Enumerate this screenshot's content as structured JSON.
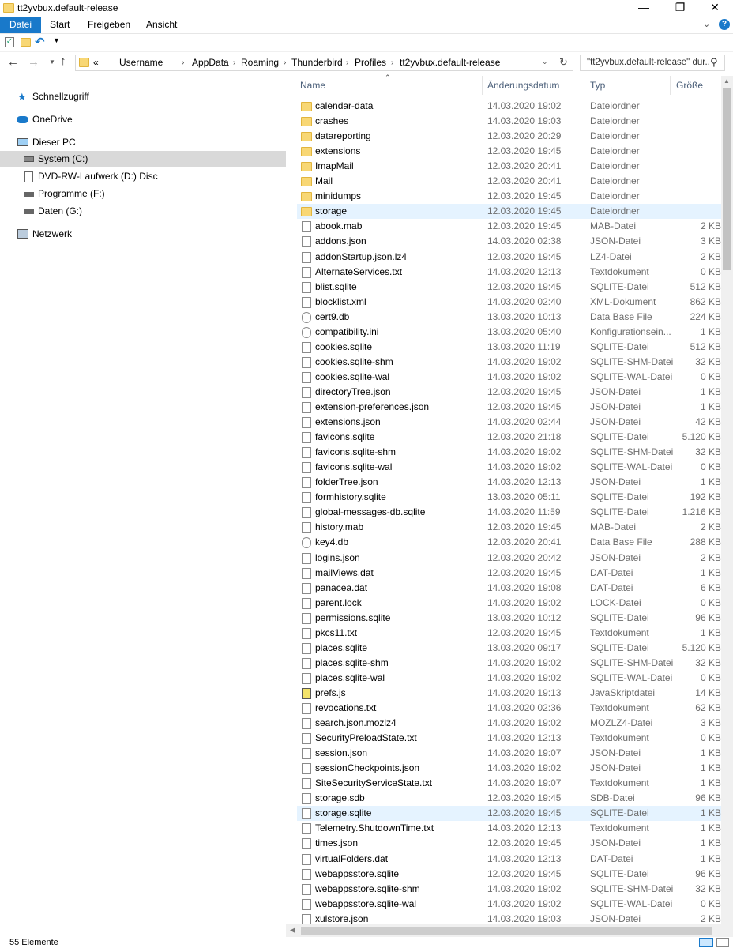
{
  "window": {
    "title": "tt2yvbux.default-release"
  },
  "ribbon": {
    "tabs": [
      "Datei",
      "Start",
      "Freigeben",
      "Ansicht"
    ]
  },
  "address": {
    "prefix": "«",
    "crumbs": [
      "Username",
      "AppData",
      "Roaming",
      "Thunderbird",
      "Profiles",
      "tt2yvbux.default-release"
    ]
  },
  "search": {
    "placeholder": "\"tt2yvbux.default-release\" dur..."
  },
  "nav": {
    "items": [
      {
        "label": "Schnellzugriff",
        "icon": "star-icon"
      },
      {
        "label": "OneDrive",
        "icon": "cloud-icon"
      },
      {
        "label": "Dieser PC",
        "icon": "computer-icon"
      },
      {
        "label": "System (C:)",
        "icon": "drive-icon"
      },
      {
        "label": "DVD-RW-Laufwerk (D:) Disc",
        "icon": "disc-icon"
      },
      {
        "label": "Programme (F:)",
        "icon": "drive-icon"
      },
      {
        "label": "Daten (G:)",
        "icon": "drive-icon"
      },
      {
        "label": "Netzwerk",
        "icon": "network-icon"
      }
    ]
  },
  "columns": {
    "name": "Name",
    "date": "Änderungsdatum",
    "type": "Typ",
    "size": "Größe"
  },
  "files": [
    {
      "name": "calendar-data",
      "date": "14.03.2020 19:02",
      "type": "Dateiordner",
      "size": "",
      "kind": "folder"
    },
    {
      "name": "crashes",
      "date": "14.03.2020 19:03",
      "type": "Dateiordner",
      "size": "",
      "kind": "folder"
    },
    {
      "name": "datareporting",
      "date": "12.03.2020 20:29",
      "type": "Dateiordner",
      "size": "",
      "kind": "folder"
    },
    {
      "name": "extensions",
      "date": "12.03.2020 19:45",
      "type": "Dateiordner",
      "size": "",
      "kind": "folder"
    },
    {
      "name": "ImapMail",
      "date": "12.03.2020 20:41",
      "type": "Dateiordner",
      "size": "",
      "kind": "folder"
    },
    {
      "name": "Mail",
      "date": "12.03.2020 20:41",
      "type": "Dateiordner",
      "size": "",
      "kind": "folder"
    },
    {
      "name": "minidumps",
      "date": "12.03.2020 19:45",
      "type": "Dateiordner",
      "size": "",
      "kind": "folder"
    },
    {
      "name": "storage",
      "date": "12.03.2020 19:45",
      "type": "Dateiordner",
      "size": "",
      "kind": "folder"
    },
    {
      "name": "abook.mab",
      "date": "12.03.2020 19:45",
      "type": "MAB-Datei",
      "size": "2 KB",
      "kind": "file"
    },
    {
      "name": "addons.json",
      "date": "14.03.2020 02:38",
      "type": "JSON-Datei",
      "size": "3 KB",
      "kind": "file"
    },
    {
      "name": "addonStartup.json.lz4",
      "date": "12.03.2020 19:45",
      "type": "LZ4-Datei",
      "size": "2 KB",
      "kind": "file"
    },
    {
      "name": "AlternateServices.txt",
      "date": "14.03.2020 12:13",
      "type": "Textdokument",
      "size": "0 KB",
      "kind": "file"
    },
    {
      "name": "blist.sqlite",
      "date": "12.03.2020 19:45",
      "type": "SQLITE-Datei",
      "size": "512 KB",
      "kind": "file"
    },
    {
      "name": "blocklist.xml",
      "date": "14.03.2020 02:40",
      "type": "XML-Dokument",
      "size": "862 KB",
      "kind": "file"
    },
    {
      "name": "cert9.db",
      "date": "13.03.2020 10:13",
      "type": "Data Base File",
      "size": "224 KB",
      "kind": "gear"
    },
    {
      "name": "compatibility.ini",
      "date": "13.03.2020 05:40",
      "type": "Konfigurationsein...",
      "size": "1 KB",
      "kind": "gear"
    },
    {
      "name": "cookies.sqlite",
      "date": "13.03.2020 11:19",
      "type": "SQLITE-Datei",
      "size": "512 KB",
      "kind": "file"
    },
    {
      "name": "cookies.sqlite-shm",
      "date": "14.03.2020 19:02",
      "type": "SQLITE-SHM-Datei",
      "size": "32 KB",
      "kind": "file"
    },
    {
      "name": "cookies.sqlite-wal",
      "date": "14.03.2020 19:02",
      "type": "SQLITE-WAL-Datei",
      "size": "0 KB",
      "kind": "file"
    },
    {
      "name": "directoryTree.json",
      "date": "12.03.2020 19:45",
      "type": "JSON-Datei",
      "size": "1 KB",
      "kind": "file"
    },
    {
      "name": "extension-preferences.json",
      "date": "12.03.2020 19:45",
      "type": "JSON-Datei",
      "size": "1 KB",
      "kind": "file"
    },
    {
      "name": "extensions.json",
      "date": "14.03.2020 02:44",
      "type": "JSON-Datei",
      "size": "42 KB",
      "kind": "file"
    },
    {
      "name": "favicons.sqlite",
      "date": "12.03.2020 21:18",
      "type": "SQLITE-Datei",
      "size": "5.120 KB",
      "kind": "file"
    },
    {
      "name": "favicons.sqlite-shm",
      "date": "14.03.2020 19:02",
      "type": "SQLITE-SHM-Datei",
      "size": "32 KB",
      "kind": "file"
    },
    {
      "name": "favicons.sqlite-wal",
      "date": "14.03.2020 19:02",
      "type": "SQLITE-WAL-Datei",
      "size": "0 KB",
      "kind": "file"
    },
    {
      "name": "folderTree.json",
      "date": "14.03.2020 12:13",
      "type": "JSON-Datei",
      "size": "1 KB",
      "kind": "file"
    },
    {
      "name": "formhistory.sqlite",
      "date": "13.03.2020 05:11",
      "type": "SQLITE-Datei",
      "size": "192 KB",
      "kind": "file"
    },
    {
      "name": "global-messages-db.sqlite",
      "date": "14.03.2020 11:59",
      "type": "SQLITE-Datei",
      "size": "1.216 KB",
      "kind": "file"
    },
    {
      "name": "history.mab",
      "date": "12.03.2020 19:45",
      "type": "MAB-Datei",
      "size": "2 KB",
      "kind": "file"
    },
    {
      "name": "key4.db",
      "date": "12.03.2020 20:41",
      "type": "Data Base File",
      "size": "288 KB",
      "kind": "gear"
    },
    {
      "name": "logins.json",
      "date": "12.03.2020 20:42",
      "type": "JSON-Datei",
      "size": "2 KB",
      "kind": "file"
    },
    {
      "name": "mailViews.dat",
      "date": "12.03.2020 19:45",
      "type": "DAT-Datei",
      "size": "1 KB",
      "kind": "file"
    },
    {
      "name": "panacea.dat",
      "date": "14.03.2020 19:08",
      "type": "DAT-Datei",
      "size": "6 KB",
      "kind": "file"
    },
    {
      "name": "parent.lock",
      "date": "14.03.2020 19:02",
      "type": "LOCK-Datei",
      "size": "0 KB",
      "kind": "file"
    },
    {
      "name": "permissions.sqlite",
      "date": "13.03.2020 10:12",
      "type": "SQLITE-Datei",
      "size": "96 KB",
      "kind": "file"
    },
    {
      "name": "pkcs11.txt",
      "date": "12.03.2020 19:45",
      "type": "Textdokument",
      "size": "1 KB",
      "kind": "file"
    },
    {
      "name": "places.sqlite",
      "date": "13.03.2020 09:17",
      "type": "SQLITE-Datei",
      "size": "5.120 KB",
      "kind": "file"
    },
    {
      "name": "places.sqlite-shm",
      "date": "14.03.2020 19:02",
      "type": "SQLITE-SHM-Datei",
      "size": "32 KB",
      "kind": "file"
    },
    {
      "name": "places.sqlite-wal",
      "date": "14.03.2020 19:02",
      "type": "SQLITE-WAL-Datei",
      "size": "0 KB",
      "kind": "file"
    },
    {
      "name": "prefs.js",
      "date": "14.03.2020 19:13",
      "type": "JavaSkriptdatei",
      "size": "14 KB",
      "kind": "js"
    },
    {
      "name": "revocations.txt",
      "date": "14.03.2020 02:36",
      "type": "Textdokument",
      "size": "62 KB",
      "kind": "file"
    },
    {
      "name": "search.json.mozlz4",
      "date": "14.03.2020 19:02",
      "type": "MOZLZ4-Datei",
      "size": "3 KB",
      "kind": "file"
    },
    {
      "name": "SecurityPreloadState.txt",
      "date": "14.03.2020 12:13",
      "type": "Textdokument",
      "size": "0 KB",
      "kind": "file"
    },
    {
      "name": "session.json",
      "date": "14.03.2020 19:07",
      "type": "JSON-Datei",
      "size": "1 KB",
      "kind": "file"
    },
    {
      "name": "sessionCheckpoints.json",
      "date": "14.03.2020 19:02",
      "type": "JSON-Datei",
      "size": "1 KB",
      "kind": "file"
    },
    {
      "name": "SiteSecurityServiceState.txt",
      "date": "14.03.2020 19:07",
      "type": "Textdokument",
      "size": "1 KB",
      "kind": "file"
    },
    {
      "name": "storage.sdb",
      "date": "12.03.2020 19:45",
      "type": "SDB-Datei",
      "size": "96 KB",
      "kind": "file"
    },
    {
      "name": "storage.sqlite",
      "date": "12.03.2020 19:45",
      "type": "SQLITE-Datei",
      "size": "1 KB",
      "kind": "file"
    },
    {
      "name": "Telemetry.ShutdownTime.txt",
      "date": "14.03.2020 12:13",
      "type": "Textdokument",
      "size": "1 KB",
      "kind": "file"
    },
    {
      "name": "times.json",
      "date": "12.03.2020 19:45",
      "type": "JSON-Datei",
      "size": "1 KB",
      "kind": "file"
    },
    {
      "name": "virtualFolders.dat",
      "date": "14.03.2020 12:13",
      "type": "DAT-Datei",
      "size": "1 KB",
      "kind": "file"
    },
    {
      "name": "webappsstore.sqlite",
      "date": "12.03.2020 19:45",
      "type": "SQLITE-Datei",
      "size": "96 KB",
      "kind": "file"
    },
    {
      "name": "webappsstore.sqlite-shm",
      "date": "14.03.2020 19:02",
      "type": "SQLITE-SHM-Datei",
      "size": "32 KB",
      "kind": "file"
    },
    {
      "name": "webappsstore.sqlite-wal",
      "date": "14.03.2020 19:02",
      "type": "SQLITE-WAL-Datei",
      "size": "0 KB",
      "kind": "file"
    },
    {
      "name": "xulstore.json",
      "date": "14.03.2020 19:03",
      "type": "JSON-Datei",
      "size": "2 KB",
      "kind": "file"
    }
  ],
  "status": {
    "count": "55 Elemente"
  },
  "colors": {
    "accent": "#1979ca",
    "folder": "#f8d775",
    "selection": "#e5f3ff"
  }
}
